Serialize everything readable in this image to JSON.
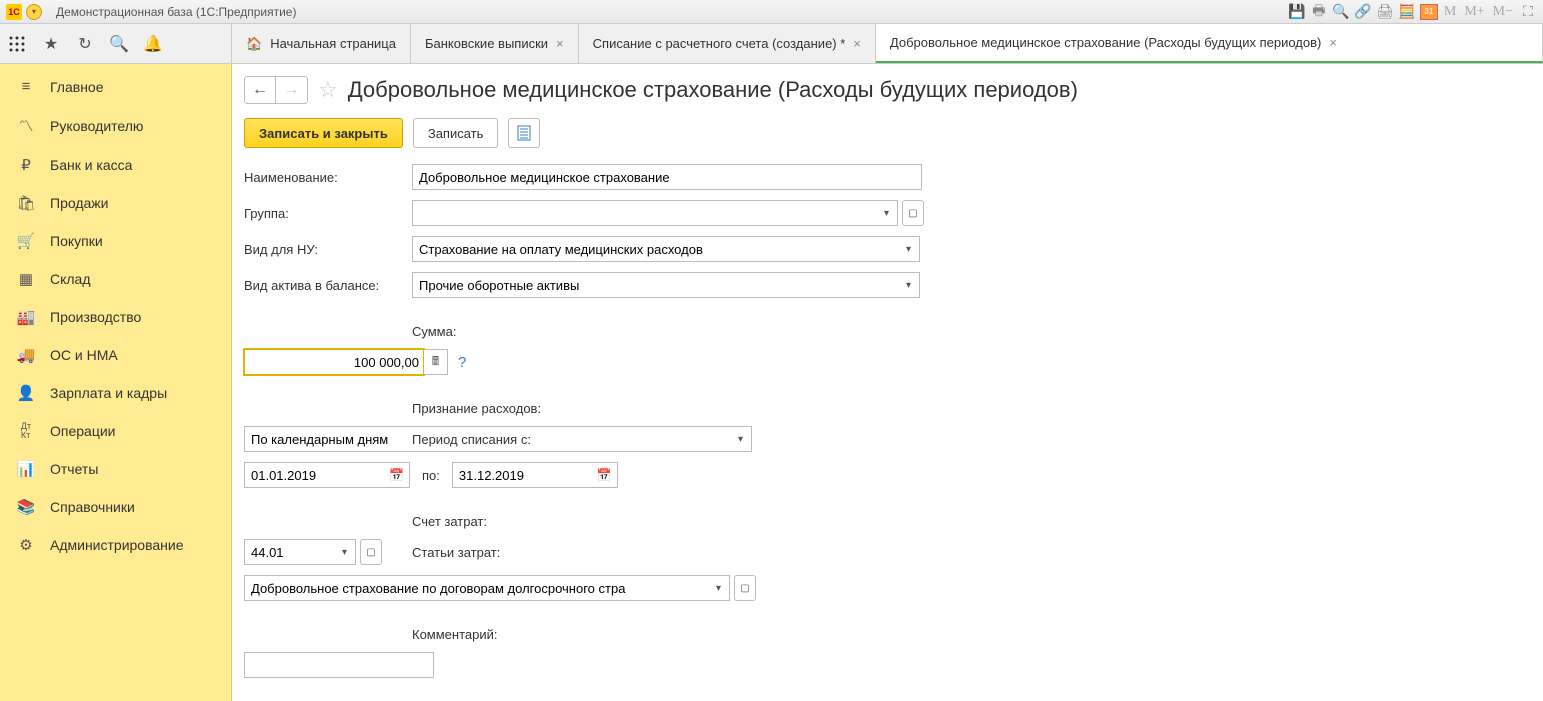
{
  "window": {
    "title": "Демонстрационная база (1С:Предприятие)"
  },
  "tabs": {
    "home": "Начальная страница",
    "t1": "Банковские выписки",
    "t2": "Списание с расчетного счета (создание) *",
    "t3": "Добровольное медицинское страхование (Расходы будущих периодов)"
  },
  "sidebar": {
    "items": [
      {
        "label": "Главное"
      },
      {
        "label": "Руководителю"
      },
      {
        "label": "Банк и касса"
      },
      {
        "label": "Продажи"
      },
      {
        "label": "Покупки"
      },
      {
        "label": "Склад"
      },
      {
        "label": "Производство"
      },
      {
        "label": "ОС и НМА"
      },
      {
        "label": "Зарплата и кадры"
      },
      {
        "label": "Операции"
      },
      {
        "label": "Отчеты"
      },
      {
        "label": "Справочники"
      },
      {
        "label": "Администрирование"
      }
    ]
  },
  "page": {
    "title": "Добровольное медицинское страхование (Расходы будущих периодов)",
    "save_close": "Записать и закрыть",
    "save": "Записать"
  },
  "form": {
    "name_lbl": "Наименование:",
    "name": "Добровольное медицинское страхование",
    "group_lbl": "Группа:",
    "group": "",
    "nu_lbl": "Вид для НУ:",
    "nu": "Страхование на оплату медицинских расходов",
    "asset_lbl": "Вид актива в балансе:",
    "asset": "Прочие оборотные активы",
    "sum_lbl": "Сумма:",
    "sum": "100 000,00",
    "recog_lbl": "Признание расходов:",
    "recog": "По календарным дням",
    "period_lbl": "Период списания с:",
    "period_from": "01.01.2019",
    "period_to_lbl": "по:",
    "period_to": "31.12.2019",
    "acc_lbl": "Счет затрат:",
    "acc": "44.01",
    "stat_lbl": "Статьи затрат:",
    "stat": "Добровольное страхование по договорам долгосрочного стра",
    "comment_lbl": "Комментарий:",
    "comment": ""
  }
}
